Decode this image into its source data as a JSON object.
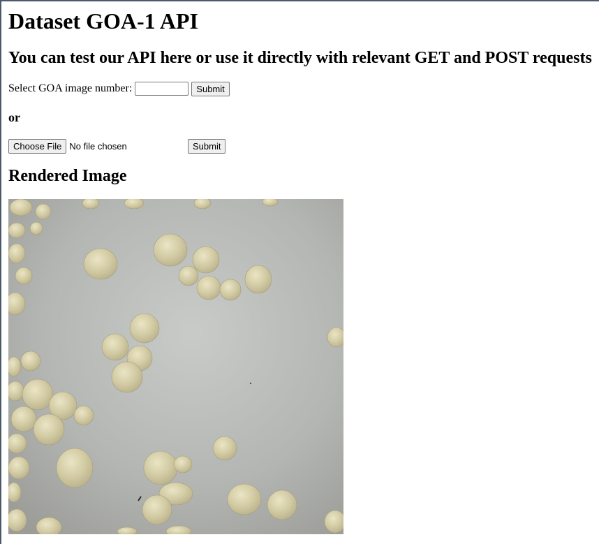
{
  "header": {
    "title": "Dataset GOA-1 API",
    "subtitle": "You can test our API here or use it directly with relevant GET and POST requests"
  },
  "form_number": {
    "label": "Select GOA image number:",
    "value": "",
    "placeholder": "",
    "submit_label": "Submit"
  },
  "separator": {
    "text": "or"
  },
  "form_file": {
    "choose_label": "Choose File",
    "status": "No file chosen",
    "submit_label": "Submit"
  },
  "rendered": {
    "heading": "Rendered Image",
    "image_description_icon": "seed-photo-image"
  },
  "colors": {
    "image_background": "#a9aaa6",
    "seed_fill": "#cfc8a2",
    "seed_highlight": "#e6e0c0",
    "button_background": "#efefef",
    "button_border": "#767676"
  }
}
